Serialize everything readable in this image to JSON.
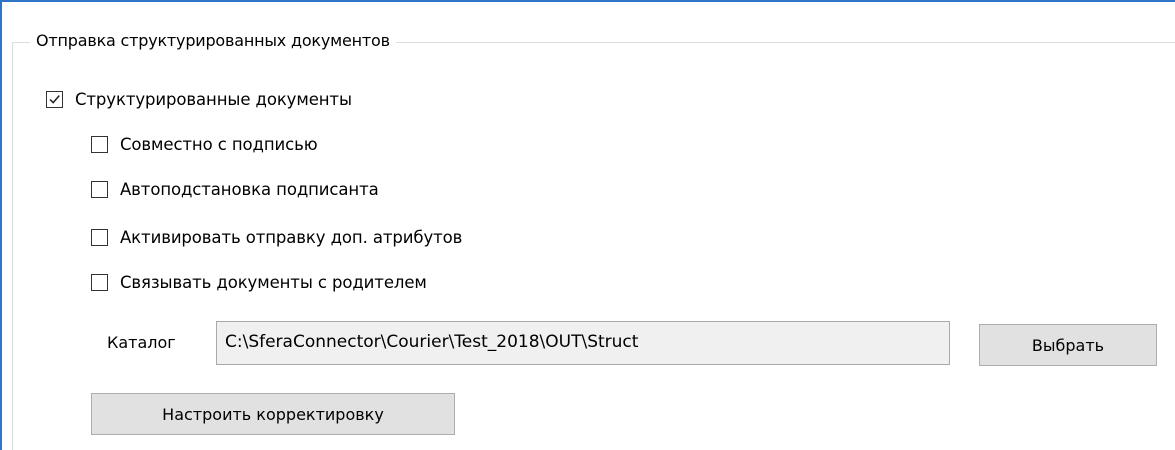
{
  "group": {
    "title": "Отправка структурированных документов"
  },
  "options": {
    "structured": {
      "label": "Структурированные документы",
      "checked": true
    },
    "with_signature": {
      "label": "Совместно с подписью",
      "checked": false
    },
    "auto_signer": {
      "label": "Автоподстановка подписанта",
      "checked": false
    },
    "extra_attributes": {
      "label": "Активировать отправку доп. атрибутов",
      "checked": false
    },
    "link_parent": {
      "label": "Связывать документы с родителем",
      "checked": false
    }
  },
  "catalog": {
    "label": "Каталог",
    "value": "C:\\SferaConnector\\Courier\\Test_2018\\OUT\\Struct",
    "browse_label": "Выбрать"
  },
  "adjust_button_label": "Настроить корректировку",
  "colors": {
    "window_border": "#2e75c7",
    "input_background": "#f0f0f0",
    "button_background": "#e1e1e1"
  }
}
